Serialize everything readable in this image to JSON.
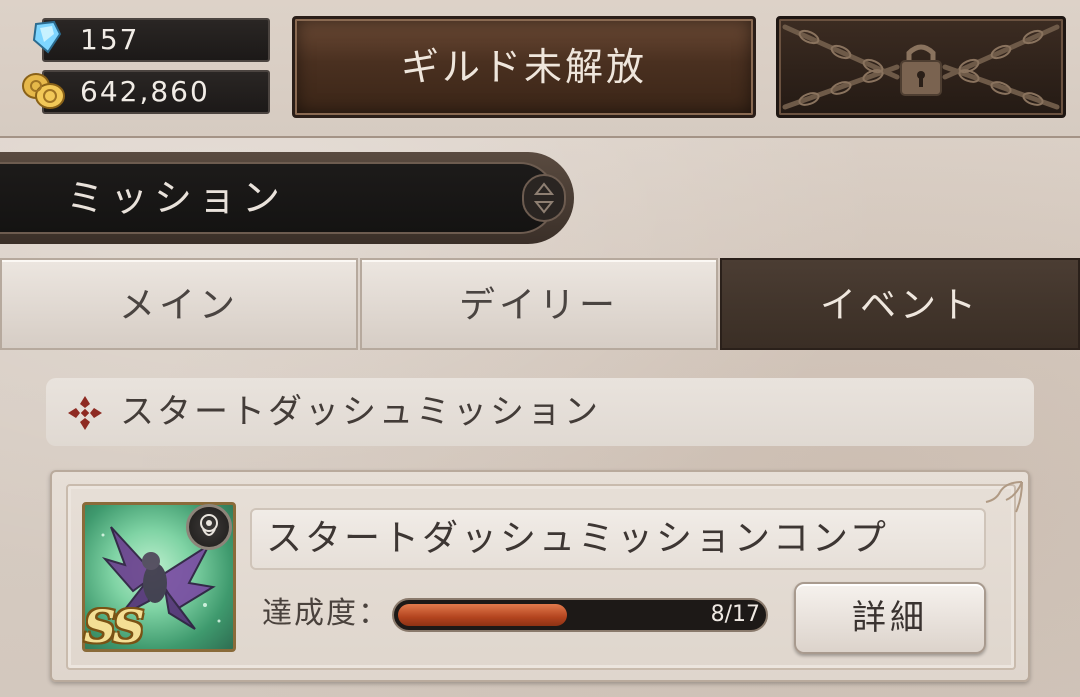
{
  "resources": {
    "gems": "157",
    "gold": "642,860"
  },
  "header": {
    "guild_button": "ギルド未解放"
  },
  "page": {
    "title": "ミッション"
  },
  "tabs": [
    {
      "label": "メイン",
      "active": false
    },
    {
      "label": "デイリー",
      "active": false
    },
    {
      "label": "イベント",
      "active": true
    }
  ],
  "section": {
    "title": "スタートダッシュミッション"
  },
  "mission": {
    "name": "スタートダッシュミッションコンプ",
    "reward_rank": "SS",
    "progress_label": "達成度：",
    "progress_current": 8,
    "progress_total": 17,
    "progress_text": "8/17",
    "detail_button": "詳細"
  },
  "colors": {
    "active_tab": "#3a2e25",
    "progress_fill": "#b3441f",
    "guild_button": "#4a3020"
  },
  "icons": {
    "gem": "crystal-icon",
    "gold": "coin-stack-icon",
    "locked": "chained-padlock-icon",
    "sort": "sort-toggle-icon",
    "section": "cross-ornament-icon",
    "element": "element-badge-icon"
  }
}
